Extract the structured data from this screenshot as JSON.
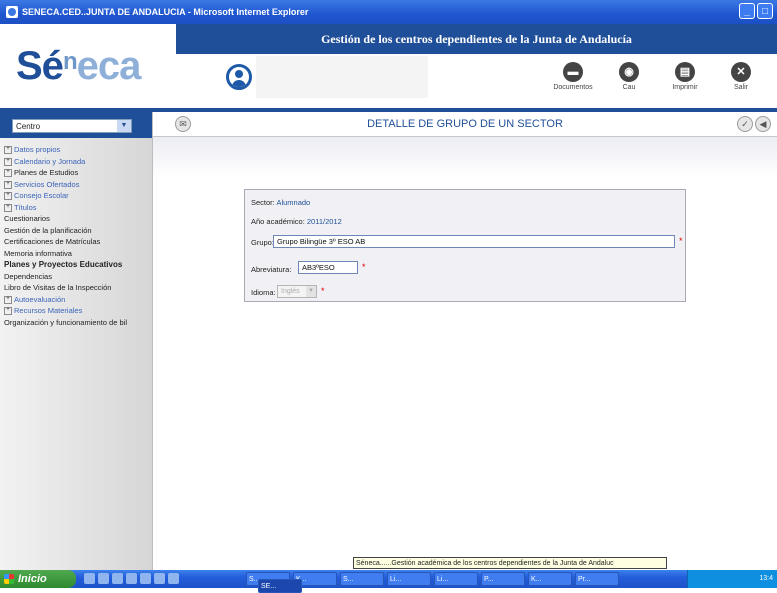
{
  "window": {
    "title": "SENECA.CED..JUNTA DE ANDALUCIA - Microsoft Internet Explorer"
  },
  "header": {
    "title": "Gestión de los centros dependientes de la Junta de Andalucía",
    "logo_prefix": "Sé",
    "logo_sup": "n",
    "logo_suffix": "eca",
    "buttons": [
      {
        "label": "Documentos",
        "icon": "document-icon"
      },
      {
        "label": "Cau",
        "icon": "cau-icon"
      },
      {
        "label": "Imprimir",
        "icon": "print-icon"
      },
      {
        "label": "Salir",
        "icon": "exit-icon"
      }
    ]
  },
  "sidebar": {
    "select_value": "Centro",
    "items": [
      {
        "label": "Datos propios",
        "expandable": true,
        "style": "light"
      },
      {
        "label": "Calendario y Jornada",
        "expandable": true,
        "style": "light"
      },
      {
        "label": "Planes de Estudios",
        "expandable": true,
        "style": "normal"
      },
      {
        "label": "Servicios Ofertados",
        "expandable": true,
        "style": "light"
      },
      {
        "label": "Consejo Escolar",
        "expandable": true,
        "style": "light"
      },
      {
        "label": "Títulos",
        "expandable": true,
        "style": "light"
      },
      {
        "label": "Cuestionarios",
        "expandable": false,
        "style": "normal"
      },
      {
        "label": "Gestión de la planificación",
        "expandable": false,
        "style": "normal"
      },
      {
        "label": "Certificaciones de Matrículas",
        "expandable": false,
        "style": "normal"
      },
      {
        "label": "Memoria informativa",
        "expandable": false,
        "style": "normal"
      },
      {
        "label": "Planes y Proyectos Educativos",
        "expandable": false,
        "style": "bold"
      },
      {
        "label": "Dependencias",
        "expandable": false,
        "style": "normal"
      },
      {
        "label": "Libro de Visitas de la Inspección",
        "expandable": false,
        "style": "normal"
      },
      {
        "label": "Autoevaluación",
        "expandable": true,
        "style": "light"
      },
      {
        "label": "Recursos Materiales",
        "expandable": true,
        "style": "light"
      },
      {
        "label": "Organización y funcionamiento de bil",
        "expandable": false,
        "style": "normal"
      }
    ]
  },
  "content": {
    "page_title": "DETALLE DE GRUPO DE UN SECTOR",
    "form": {
      "sector_label": "Sector:",
      "sector_value": "Alumnado",
      "year_label": "Año académico:",
      "year_value": "2011/2012",
      "grupo_label": "Grupo:",
      "grupo_value": "Grupo Bilingüe 3º ESO AB",
      "abrev_label": "Abreviatura:",
      "abrev_value": "AB3ºESO",
      "idioma_label": "Idioma:",
      "idioma_value": "Inglés",
      "required_mark": "*"
    }
  },
  "tooltip": "Séneca......Gestión académica de los centros dependientes de la Junta de Andaluc",
  "taskbar": {
    "start_label": "Inicio",
    "tasks": [
      "S...",
      "K...",
      "S...",
      "Li...",
      "Li...",
      "P...",
      "K...",
      "Pr...",
      "SE..."
    ],
    "clock": "13:4"
  }
}
